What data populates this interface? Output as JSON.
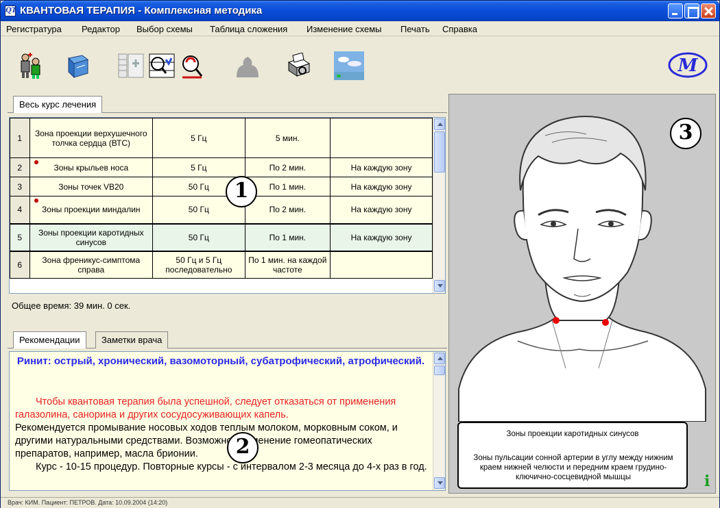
{
  "window": {
    "title": "КВАНТОВАЯ ТЕРАПИЯ - Комплексная методика"
  },
  "menu": [
    "Регистратура",
    "Редактор",
    "Выбор схемы",
    "Таблица сложения",
    "Изменение схемы",
    "Печать",
    "Справка"
  ],
  "toolbar": {
    "icons": [
      "patients-icon",
      "book-icon",
      "table-add-icon",
      "numbered-search-icon",
      "zoom-icon",
      "body-shape-icon",
      "printer-icon",
      "landscape-icon"
    ],
    "logo": "M"
  },
  "course_tab": "Весь курс лечения",
  "table": {
    "rows": [
      {
        "num": "1",
        "zone": "Зона проекции верхушечного толчка сердца (ВТС)",
        "freq": "5 Гц",
        "time": "5 мин.",
        "note": "",
        "dot": false
      },
      {
        "num": "2",
        "zone": "Зоны крыльев носа",
        "freq": "5 Гц",
        "time": "По 2 мин.",
        "note": "На каждую зону",
        "dot": true
      },
      {
        "num": "3",
        "zone": "Зоны точек VB20",
        "freq": "50 Гц",
        "time": "По 1 мин.",
        "note": "На каждую зону",
        "dot": false
      },
      {
        "num": "4",
        "zone": "Зоны проекции миндалин",
        "freq": "50 Гц",
        "time": "По 2 мин.",
        "note": "На каждую зону",
        "dot": true
      },
      {
        "num": "5",
        "zone": "Зоны проекции каротидных синусов",
        "freq": "50 Гц",
        "time": "По 1 мин.",
        "note": "На каждую зону",
        "dot": false
      },
      {
        "num": "6",
        "zone": "Зона френикус-симптома справа",
        "freq": "50 Гц и 5 Гц последовательно",
        "time": "По 1 мин. на каждой частоте",
        "note": "",
        "dot": false
      }
    ],
    "selected_row": 5
  },
  "total_time": "Общее время: 39 мин. 0 сек.",
  "tabs": {
    "recommendations": "Рекомендации",
    "notes": "Заметки врача"
  },
  "recommendation": {
    "title": "Ринит: острый, хронический, вазомоторный, субатрофический, атрофический.",
    "red_text": "Чтобы квантовая терапия была успешной, следует отказаться от применения галазолина, санорина и других сосудосуживающих капель.",
    "black_text": "Рекомендуется промывание носовых ходов теплым молоком, морковным соком, и другими натуральными средствами. Возможно применение гомеопатических препаратов, например, масла брионии.",
    "course_text": "Курс - 10-15 процедур. Повторные курсы - с интервалом 2-3 месяца до 4-х раз в год."
  },
  "callouts": {
    "one": "1",
    "two": "2",
    "three": "3"
  },
  "figure": {
    "caption_title": "Зоны проекции каротидных синусов",
    "caption_desc": "Зоны пульсации сонной артерии в углу между нижним краем нижней челюсти и передним краем грудино-ключично-сосцевидной мышцы",
    "info": "i",
    "marker_color": "#e60000"
  },
  "status": "Врач: КИМ.   Пациент: ПЕТРОВ.   Дата: 10.09.2004  (14:20)"
}
